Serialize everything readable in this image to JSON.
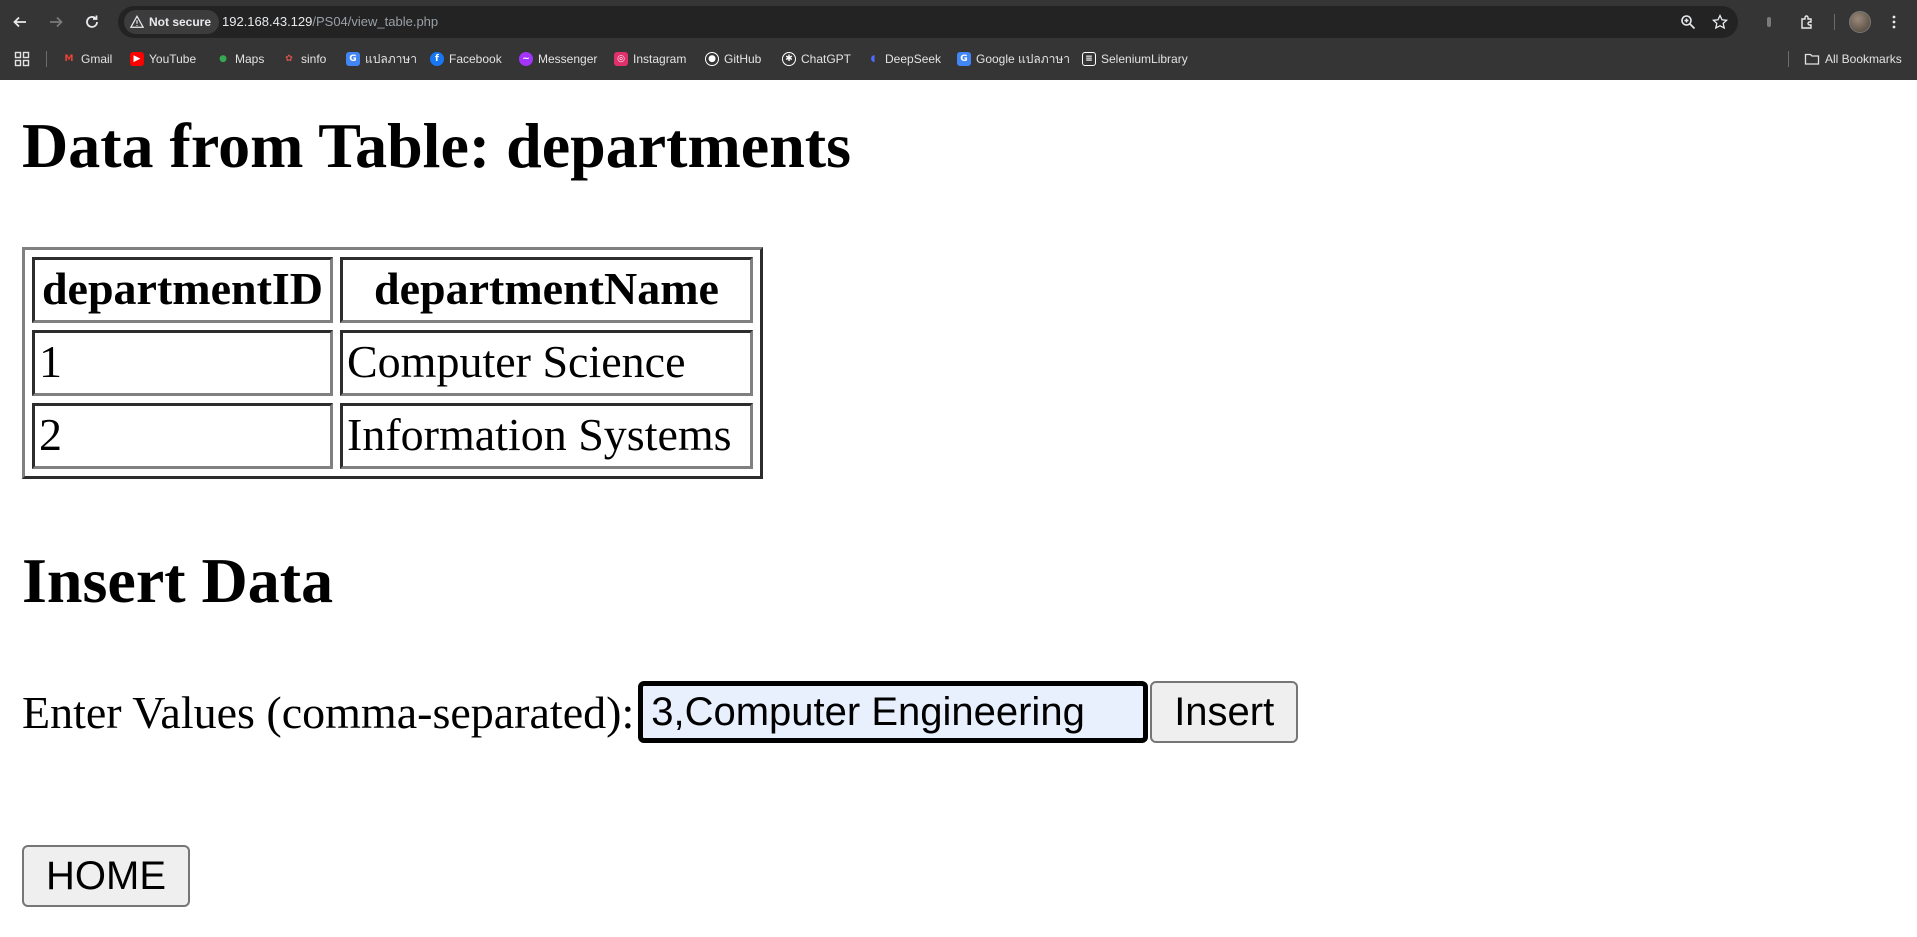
{
  "browser": {
    "security_label": "Not secure",
    "url_host": "192.168.43.129",
    "url_path": "/PS04/view_table.php",
    "bookmarks": [
      {
        "label": "Gmail",
        "icon": "gmail-icon",
        "color": "#ea4335"
      },
      {
        "label": "YouTube",
        "icon": "youtube-icon",
        "color": "#ff0000"
      },
      {
        "label": "Maps",
        "icon": "maps-icon",
        "color": "#34a853"
      },
      {
        "label": "sinfo",
        "icon": "sinfo-icon",
        "color": "#d9534f"
      },
      {
        "label": "แปลภาษา",
        "icon": "translate-icon",
        "color": "#4285f4"
      },
      {
        "label": "Facebook",
        "icon": "facebook-icon",
        "color": "#1877f2"
      },
      {
        "label": "Messenger",
        "icon": "messenger-icon",
        "color": "#a334fa"
      },
      {
        "label": "Instagram",
        "icon": "instagram-icon",
        "color": "#e1306c"
      },
      {
        "label": "GitHub",
        "icon": "github-icon",
        "color": "#ffffff"
      },
      {
        "label": "ChatGPT",
        "icon": "chatgpt-icon",
        "color": "#ffffff"
      },
      {
        "label": "DeepSeek",
        "icon": "deepseek-icon",
        "color": "#4d6bfe"
      },
      {
        "label": "Google แปลภาษา",
        "icon": "google-translate-icon",
        "color": "#4285f4"
      },
      {
        "label": "SeleniumLibrary",
        "icon": "selenium-icon",
        "color": "#ffffff"
      }
    ],
    "all_bookmarks_label": "All Bookmarks"
  },
  "page": {
    "title": "Data from Table: departments",
    "table": {
      "headers": [
        "departmentID",
        "departmentName"
      ],
      "rows": [
        [
          "1",
          "Computer Science"
        ],
        [
          "2",
          "Information Systems"
        ]
      ]
    },
    "insert_title": "Insert Data",
    "form": {
      "label": "Enter Values (comma-separated):",
      "input_value": "3,Computer Engineering",
      "insert_button": "Insert"
    },
    "home_button": "HOME"
  }
}
